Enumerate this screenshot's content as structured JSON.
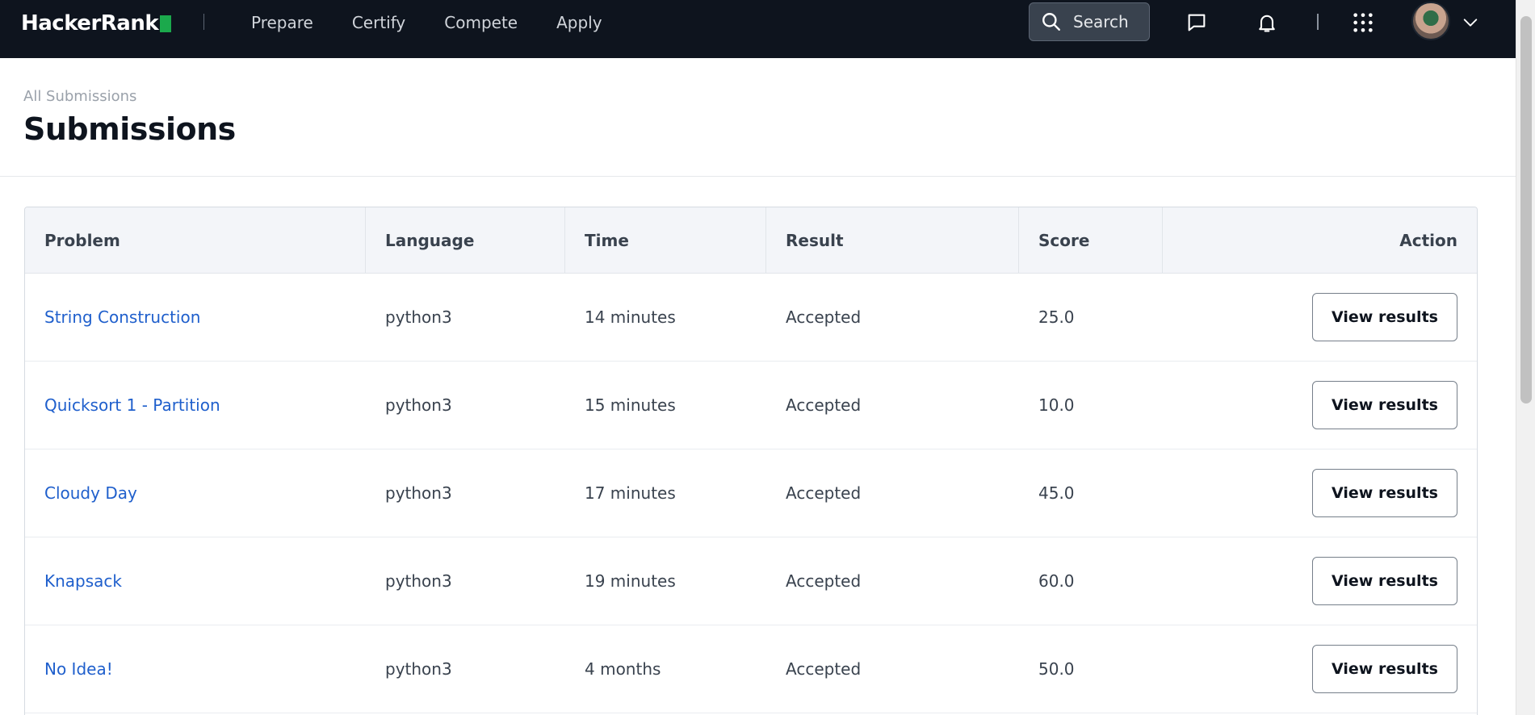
{
  "nav": {
    "brand": "HackerRank",
    "links": [
      "Prepare",
      "Certify",
      "Compete",
      "Apply"
    ],
    "search_label": "Search",
    "icons": [
      "message-icon",
      "bell-icon",
      "apps-grid-icon",
      "chevron-down-icon"
    ],
    "colors": {
      "bg": "#0e141e",
      "brand_green": "#1ba94c"
    }
  },
  "page": {
    "breadcrumb": "All Submissions",
    "title": "Submissions"
  },
  "table": {
    "headers": {
      "problem": "Problem",
      "language": "Language",
      "time": "Time",
      "result": "Result",
      "score": "Score",
      "action": "Action"
    },
    "rows": [
      {
        "problem": "String Construction",
        "language": "python3",
        "time": "14 minutes",
        "result": "Accepted",
        "score": "25.0",
        "action": "View results"
      },
      {
        "problem": "Quicksort 1 - Partition",
        "language": "python3",
        "time": "15 minutes",
        "result": "Accepted",
        "score": "10.0",
        "action": "View results"
      },
      {
        "problem": "Cloudy Day",
        "language": "python3",
        "time": "17 minutes",
        "result": "Accepted",
        "score": "45.0",
        "action": "View results"
      },
      {
        "problem": "Knapsack",
        "language": "python3",
        "time": "19 minutes",
        "result": "Accepted",
        "score": "60.0",
        "action": "View results"
      },
      {
        "problem": "No Idea!",
        "language": "python3",
        "time": "4 months",
        "result": "Accepted",
        "score": "50.0",
        "action": "View results"
      }
    ]
  }
}
